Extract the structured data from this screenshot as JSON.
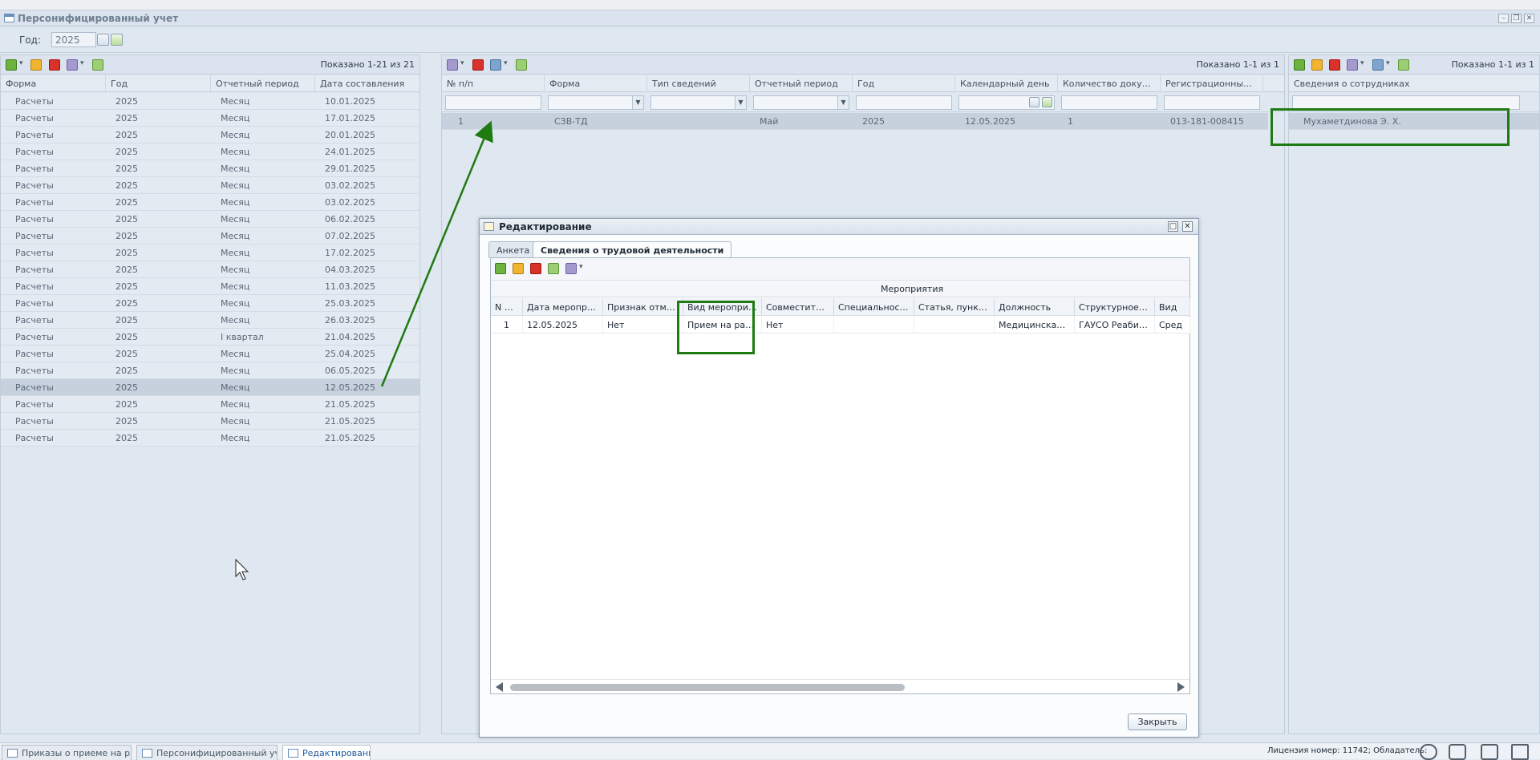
{
  "window": {
    "title": "Персонифицированный учет"
  },
  "year_filter": {
    "label": "Год:",
    "value": "2025"
  },
  "left_panel": {
    "shown": "Показано 1-21 из 21",
    "columns": [
      "Форма",
      "Год",
      "Отчетный период",
      "Дата составления"
    ],
    "rows": [
      [
        "Расчеты",
        "2025",
        "Месяц",
        "10.01.2025"
      ],
      [
        "Расчеты",
        "2025",
        "Месяц",
        "17.01.2025"
      ],
      [
        "Расчеты",
        "2025",
        "Месяц",
        "20.01.2025"
      ],
      [
        "Расчеты",
        "2025",
        "Месяц",
        "24.01.2025"
      ],
      [
        "Расчеты",
        "2025",
        "Месяц",
        "29.01.2025"
      ],
      [
        "Расчеты",
        "2025",
        "Месяц",
        "03.02.2025"
      ],
      [
        "Расчеты",
        "2025",
        "Месяц",
        "03.02.2025"
      ],
      [
        "Расчеты",
        "2025",
        "Месяц",
        "06.02.2025"
      ],
      [
        "Расчеты",
        "2025",
        "Месяц",
        "07.02.2025"
      ],
      [
        "Расчеты",
        "2025",
        "Месяц",
        "17.02.2025"
      ],
      [
        "Расчеты",
        "2025",
        "Месяц",
        "04.03.2025"
      ],
      [
        "Расчеты",
        "2025",
        "Месяц",
        "11.03.2025"
      ],
      [
        "Расчеты",
        "2025",
        "Месяц",
        "25.03.2025"
      ],
      [
        "Расчеты",
        "2025",
        "Месяц",
        "26.03.2025"
      ],
      [
        "Расчеты",
        "2025",
        "I квартал",
        "21.04.2025"
      ],
      [
        "Расчеты",
        "2025",
        "Месяц",
        "25.04.2025"
      ],
      [
        "Расчеты",
        "2025",
        "Месяц",
        "06.05.2025"
      ],
      [
        "Расчеты",
        "2025",
        "Месяц",
        "12.05.2025"
      ],
      [
        "Расчеты",
        "2025",
        "Месяц",
        "21.05.2025"
      ],
      [
        "Расчеты",
        "2025",
        "Месяц",
        "21.05.2025"
      ],
      [
        "Расчеты",
        "2025",
        "Месяц",
        "21.05.2025"
      ]
    ],
    "selected_index": 17
  },
  "middle_panel": {
    "shown": "Показано 1-1 из 1",
    "columns": [
      "№ п/п",
      "Форма",
      "Тип сведений",
      "Отчетный период",
      "Год",
      "Календарный день",
      "Количество докумен...",
      "Регистрационный но..."
    ],
    "rows": [
      [
        "1",
        "СЗВ-ТД",
        "",
        "Май",
        "2025",
        "12.05.2025",
        "1",
        "013-181-008415"
      ]
    ]
  },
  "right_panel": {
    "shown": "Показано 1-1 из 1",
    "column": "Сведения о сотрудниках",
    "rows": [
      "Мухаметдинова Э. Х."
    ]
  },
  "modal": {
    "title": "Редактирование",
    "tabs": [
      "Анкета",
      "Сведения о трудовой деятельности"
    ],
    "active_tab": 1,
    "group_header": "Мероприятия",
    "columns": [
      "N п/п",
      "Дата мероприя...",
      "Признак отмен...",
      "Вид мероприятия",
      "Совместитель",
      "Специальность,...",
      "Статья, пункт Т...",
      "Должность",
      "Структурное по...",
      "Вид"
    ],
    "rows": [
      [
        "1",
        "12.05.2025",
        "Нет",
        "Прием на работу",
        "Нет",
        "",
        "",
        "Медицинская с...",
        "ГАУСО Реабили...",
        "Сред"
      ]
    ],
    "close_label": "Закрыть"
  },
  "taskbar": {
    "tasks": [
      "Приказы о приеме на ра...",
      "Персонифицированный учет",
      "Редактирование"
    ],
    "active_task": 2,
    "license": "Лицензия номер: 11742; Обладатель:"
  },
  "colors": {
    "highlight": "#1f7a12",
    "panel_bg": "#dfe8f1",
    "selected_row": "#c6d1dd"
  }
}
